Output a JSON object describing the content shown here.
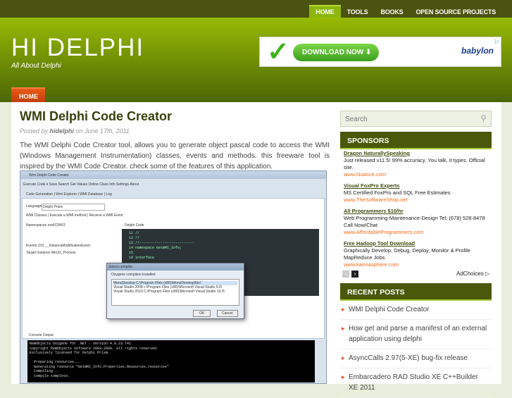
{
  "nav": {
    "items": [
      {
        "label": "HOME",
        "active": true
      },
      {
        "label": "TOOLS"
      },
      {
        "label": "BOOKS"
      },
      {
        "label": "OPEN SOURCE PROJECTS"
      }
    ]
  },
  "header": {
    "title": "HI DELPHI",
    "tagline": "All About Delphi",
    "ad": {
      "button": "DOWNLOAD NOW ⬇",
      "brand": "babylon"
    }
  },
  "subnav": {
    "home": "HOME"
  },
  "post": {
    "title": "WMI Delphi Code Creator",
    "posted_by_prefix": "Posted by ",
    "author": "hidelphi",
    "date_text": " on June 17th, 2011",
    "body": "The WMI Delphi Code Creator tool, allows you to generate object pascal code to access the WMI (Windows Management Instrumentation) classes, events and methods. this freeware tool is inspired by the WMI Code Creator. check some of the features of this application.",
    "screenshot": {
      "window_title": "Wmi Delphi Code Creator",
      "toolbar": "Execute Code ▾  Save  Search  Get Values  Online Class Info  Settings  About",
      "tabs": "Code Generation | Wmi Explorer | WMI Database | Log",
      "language_label": "Language",
      "language_value": "Delphi Prism",
      "subtabs": "WMI Classes | Execute a WMI method | Receive a WMI Event",
      "namespaces": "Namespaces   root\\CIMV2",
      "events": "Events (15)   __InstanceModificationEvent",
      "target": "Target Instance   Win32_Process",
      "code_tab": "Delphi Code",
      "code": "11 //\n12 //\n13 //--------------------------\n14 namespace GetWMI_Info;\n15\n16 interface",
      "dialog_title": "Select compiler",
      "dialog_label": "Oxygene compilers installed",
      "dialog_rows": [
        "MonoDevelop   C:\\Program Files (x86)\\MonoDevelop\\bin\\",
        "Visual Studio 2008   c:\\Program Files (x86)\\Microsoft Visual Studio 9.0\\",
        "Visual Studio 2010   C:\\Program Files (x86)\\Microsoft Visual Studio 10.0\\"
      ],
      "ok": "OK",
      "cancel": "Cancel",
      "console_tab": "Console Output",
      "console": "RemObjects Oxygene for .NET - Version 4.0.23.741\nCopyright RemObjects Software 2003-2009. All rights reserved.\nExclusively licensed for Delphi Prism.\n\n  Preparing resources...\n  Generating resource \"GetWMI_Info.Properties.Resources.resources\"\n  Compiling...\n  Compile complete."
    }
  },
  "sidebar": {
    "search_placeholder": "Search",
    "sponsors_title": "SPONSORS",
    "ads": [
      {
        "title": "Dragon NaturallySpeaking",
        "text": "Just released v11.5! 99% accuracy. You talk, it types. Official site.",
        "url": "www.Nuance.com"
      },
      {
        "title": "Visual FoxPro Experts",
        "text": "MS Certified FoxPro and SQL Free Estimates",
        "url": "www.TheSoftwareShop.net"
      },
      {
        "title": "All Programmers $10/hr",
        "text": "Web Programming-Maintenance-Design Tel: (678) 528-8478 Call Now/Chat",
        "url": "www.AffordableProgrammers.com"
      },
      {
        "title": "Free Hadoop Tool Download",
        "text": "Graphically Develop, Debug, Deploy, Monitor & Profile MapReduce Jobs",
        "url": "www.karmasphere.com"
      }
    ],
    "adchoices": "AdChoices ▷",
    "recent_title": "RECENT POSTS",
    "recent": [
      "WMI Delphi Code Creator",
      "How get and parse a manifest of an external application using delphi",
      "AsyncCalls 2.97(5-XE) bug-fix release",
      "Embarcadero RAD Studio XE C++Builder XE 2011"
    ]
  }
}
